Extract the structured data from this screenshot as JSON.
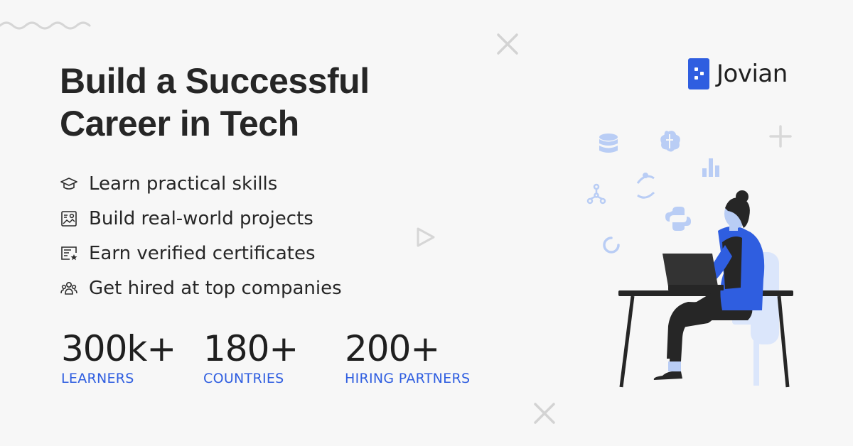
{
  "headline": {
    "line1": "Build a Successful",
    "line2": "Career in Tech"
  },
  "features": [
    {
      "icon": "graduation-cap-icon",
      "label": "Learn practical skills"
    },
    {
      "icon": "project-board-icon",
      "label": "Build real-world projects"
    },
    {
      "icon": "certificate-icon",
      "label": "Earn verified certificates"
    },
    {
      "icon": "people-group-icon",
      "label": "Get hired at top companies"
    }
  ],
  "stats": [
    {
      "value": "300k+",
      "label": "LEARNERS"
    },
    {
      "value": "180+",
      "label": "COUNTRIES"
    },
    {
      "value": "200+",
      "label": "HIRING PARTNERS"
    }
  ],
  "brand": {
    "name": "Jovian",
    "color": "#2f5ee0"
  },
  "colors": {
    "background": "#f7f7f7",
    "text": "#262626",
    "accent": "#2f5ee0",
    "illustration_light": "#b9cdf5",
    "decoration": "#d6d6d6"
  },
  "illustration_icons": [
    "database-icon",
    "brain-icon",
    "bar-chart-icon",
    "tree-network-icon",
    "orbit-icon",
    "python-icon",
    "loading-ring-icon"
  ]
}
